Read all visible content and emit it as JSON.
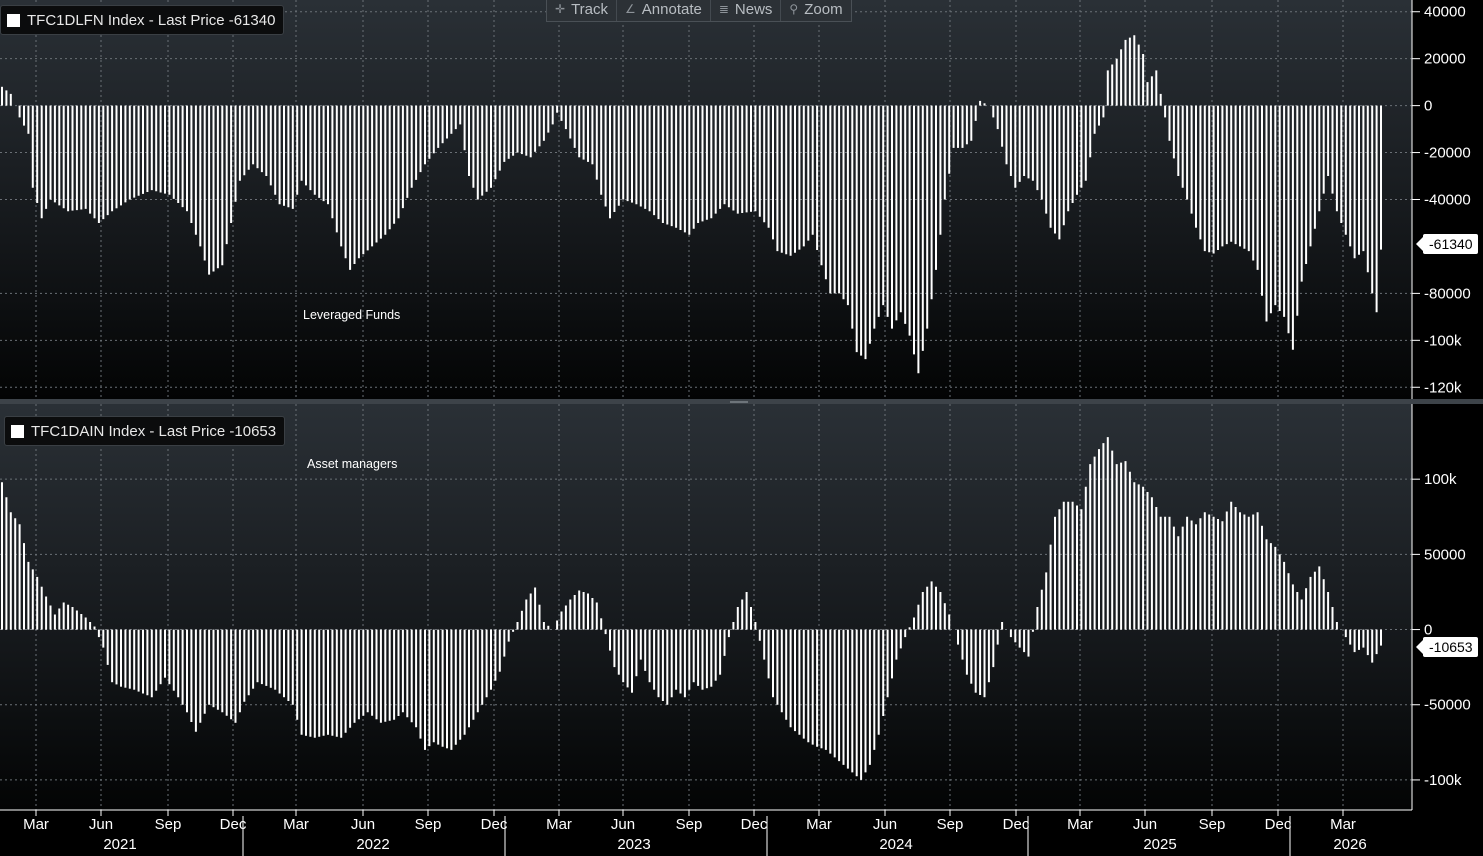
{
  "toolbar": {
    "track_label": "Track",
    "annotate_label": "Annotate",
    "news_label": "News",
    "zoom_label": "Zoom",
    "track_icon": "crosshair-icon",
    "annotate_icon": "pencil-icon",
    "news_icon": "news-icon",
    "zoom_icon": "magnifier-icon"
  },
  "x_axis": {
    "month_ticks": [
      "Mar",
      "Jun",
      "Sep",
      "Dec",
      "Mar",
      "Jun",
      "Sep",
      "Dec",
      "Mar",
      "Jun",
      "Sep",
      "Dec",
      "Mar",
      "Jun",
      "Sep",
      "Dec",
      "Mar",
      "Jun",
      "Sep",
      "Dec",
      "Mar"
    ],
    "years": [
      "2021",
      "2022",
      "2023",
      "2024",
      "2025",
      "2026"
    ]
  },
  "chart_data": [
    {
      "type": "bar",
      "legend": "TFC1DLFN Index - Last Price -61340",
      "annotation": "Leveraged Funds",
      "last_value": -61340,
      "last_label": "-61340",
      "ylim": [
        -125000,
        45000
      ],
      "yticks": [
        40000,
        20000,
        0,
        -20000,
        -40000,
        -80000,
        -100000,
        -120000
      ],
      "yticklabels": [
        "40000",
        "20000",
        "0",
        "-20000",
        "-40000",
        "-80000",
        "-100k",
        "-120k"
      ],
      "grid": true,
      "color": "#ffffff",
      "anchors": [
        [
          0,
          8000
        ],
        [
          2,
          5000
        ],
        [
          4,
          -5000
        ],
        [
          6,
          -12000
        ],
        [
          7,
          -35000
        ],
        [
          9,
          -48000
        ],
        [
          11,
          -40000
        ],
        [
          15,
          -45000
        ],
        [
          19,
          -44000
        ],
        [
          22,
          -50000
        ],
        [
          25,
          -45000
        ],
        [
          29,
          -40000
        ],
        [
          34,
          -36000
        ],
        [
          38,
          -38000
        ],
        [
          42,
          -45000
        ],
        [
          45,
          -60000
        ],
        [
          47,
          -72000
        ],
        [
          50,
          -68000
        ],
        [
          52,
          -50000
        ],
        [
          54,
          -32000
        ],
        [
          57,
          -25000
        ],
        [
          60,
          -30000
        ],
        [
          63,
          -42000
        ],
        [
          66,
          -44000
        ],
        [
          68,
          -32000
        ],
        [
          71,
          -38000
        ],
        [
          74,
          -42000
        ],
        [
          77,
          -60000
        ],
        [
          79,
          -70000
        ],
        [
          81,
          -65000
        ],
        [
          84,
          -60000
        ],
        [
          87,
          -55000
        ],
        [
          90,
          -48000
        ],
        [
          93,
          -35000
        ],
        [
          96,
          -25000
        ],
        [
          99,
          -18000
        ],
        [
          102,
          -12000
        ],
        [
          104,
          -8000
        ],
        [
          106,
          -30000
        ],
        [
          108,
          -40000
        ],
        [
          111,
          -35000
        ],
        [
          114,
          -24000
        ],
        [
          117,
          -20000
        ],
        [
          120,
          -22000
        ],
        [
          123,
          -15000
        ],
        [
          125,
          -8000
        ],
        [
          126,
          -3000
        ],
        [
          128,
          -10000
        ],
        [
          131,
          -22000
        ],
        [
          134,
          -25000
        ],
        [
          136,
          -38000
        ],
        [
          138,
          -48000
        ],
        [
          141,
          -40000
        ],
        [
          144,
          -42000
        ],
        [
          147,
          -45000
        ],
        [
          150,
          -50000
        ],
        [
          153,
          -52000
        ],
        [
          156,
          -55000
        ],
        [
          158,
          -50000
        ],
        [
          161,
          -48000
        ],
        [
          164,
          -42000
        ],
        [
          167,
          -46000
        ],
        [
          171,
          -45000
        ],
        [
          174,
          -52000
        ],
        [
          176,
          -62000
        ],
        [
          179,
          -64000
        ],
        [
          182,
          -60000
        ],
        [
          184,
          -55000
        ],
        [
          186,
          -68000
        ],
        [
          188,
          -80000
        ],
        [
          190,
          -80000
        ],
        [
          192,
          -85000
        ],
        [
          194,
          -105000
        ],
        [
          196,
          -108000
        ],
        [
          198,
          -95000
        ],
        [
          200,
          -85000
        ],
        [
          202,
          -95000
        ],
        [
          204,
          -88000
        ],
        [
          206,
          -98000
        ],
        [
          208,
          -114000
        ],
        [
          210,
          -95000
        ],
        [
          212,
          -70000
        ],
        [
          214,
          -40000
        ],
        [
          216,
          -18000
        ],
        [
          218,
          -18000
        ],
        [
          220,
          -15000
        ],
        [
          222,
          2000
        ],
        [
          224,
          0
        ],
        [
          226,
          -10000
        ],
        [
          228,
          -25000
        ],
        [
          230,
          -35000
        ],
        [
          232,
          -30000
        ],
        [
          234,
          -32000
        ],
        [
          236,
          -40000
        ],
        [
          238,
          -52000
        ],
        [
          240,
          -57000
        ],
        [
          242,
          -45000
        ],
        [
          244,
          -38000
        ],
        [
          246,
          -32000
        ],
        [
          248,
          -12000
        ],
        [
          250,
          -5000
        ],
        [
          251,
          15000
        ],
        [
          253,
          20000
        ],
        [
          255,
          28000
        ],
        [
          257,
          30000
        ],
        [
          259,
          22000
        ],
        [
          260,
          10000
        ],
        [
          262,
          15000
        ],
        [
          263,
          5000
        ],
        [
          265,
          -15000
        ],
        [
          267,
          -30000
        ],
        [
          269,
          -40000
        ],
        [
          271,
          -52000
        ],
        [
          273,
          -62000
        ],
        [
          275,
          -63000
        ],
        [
          277,
          -60000
        ],
        [
          279,
          -58000
        ],
        [
          281,
          -60000
        ],
        [
          283,
          -62000
        ],
        [
          285,
          -70000
        ],
        [
          287,
          -92000
        ],
        [
          289,
          -85000
        ],
        [
          291,
          -90000
        ],
        [
          293,
          -104000
        ],
        [
          295,
          -75000
        ],
        [
          297,
          -60000
        ],
        [
          299,
          -45000
        ],
        [
          301,
          -30000
        ],
        [
          303,
          -45000
        ],
        [
          305,
          -55000
        ],
        [
          307,
          -65000
        ],
        [
          309,
          -62000
        ],
        [
          311,
          -80000
        ],
        [
          312,
          -88000
        ],
        [
          313,
          -61340
        ]
      ]
    },
    {
      "type": "bar",
      "legend": "TFC1DAIN Index - Last Price -10653",
      "annotation": "Asset managers",
      "last_value": -10653,
      "last_label": "-10653",
      "ylim": [
        -120000,
        150000
      ],
      "yticks": [
        100000,
        50000,
        0,
        -50000,
        -100000
      ],
      "yticklabels": [
        "100k",
        "50000",
        "0",
        "-50000",
        "-100k"
      ],
      "grid": true,
      "color": "#ffffff",
      "anchors": [
        [
          0,
          98000
        ],
        [
          2,
          78000
        ],
        [
          4,
          70000
        ],
        [
          6,
          45000
        ],
        [
          8,
          35000
        ],
        [
          10,
          22000
        ],
        [
          12,
          10000
        ],
        [
          14,
          18000
        ],
        [
          16,
          15000
        ],
        [
          19,
          8000
        ],
        [
          21,
          2000
        ],
        [
          23,
          -12000
        ],
        [
          25,
          -35000
        ],
        [
          27,
          -38000
        ],
        [
          30,
          -40000
        ],
        [
          34,
          -45000
        ],
        [
          37,
          -32000
        ],
        [
          40,
          -45000
        ],
        [
          42,
          -55000
        ],
        [
          44,
          -68000
        ],
        [
          47,
          -50000
        ],
        [
          50,
          -55000
        ],
        [
          53,
          -62000
        ],
        [
          55,
          -48000
        ],
        [
          58,
          -35000
        ],
        [
          62,
          -40000
        ],
        [
          66,
          -50000
        ],
        [
          68,
          -70000
        ],
        [
          71,
          -72000
        ],
        [
          74,
          -70000
        ],
        [
          77,
          -72000
        ],
        [
          80,
          -62000
        ],
        [
          83,
          -55000
        ],
        [
          86,
          -62000
        ],
        [
          89,
          -60000
        ],
        [
          91,
          -55000
        ],
        [
          94,
          -65000
        ],
        [
          96,
          -80000
        ],
        [
          98,
          -75000
        ],
        [
          100,
          -78000
        ],
        [
          102,
          -80000
        ],
        [
          105,
          -70000
        ],
        [
          108,
          -55000
        ],
        [
          111,
          -40000
        ],
        [
          113,
          -28000
        ],
        [
          115,
          -8000
        ],
        [
          117,
          5000
        ],
        [
          119,
          20000
        ],
        [
          121,
          28000
        ],
        [
          123,
          5000
        ],
        [
          125,
          0
        ],
        [
          127,
          12000
        ],
        [
          129,
          20000
        ],
        [
          131,
          26000
        ],
        [
          133,
          24000
        ],
        [
          135,
          18000
        ],
        [
          137,
          -3000
        ],
        [
          139,
          -25000
        ],
        [
          141,
          -35000
        ],
        [
          143,
          -42000
        ],
        [
          145,
          -20000
        ],
        [
          147,
          -35000
        ],
        [
          149,
          -45000
        ],
        [
          151,
          -50000
        ],
        [
          153,
          -40000
        ],
        [
          155,
          -45000
        ],
        [
          157,
          -35000
        ],
        [
          159,
          -40000
        ],
        [
          161,
          -38000
        ],
        [
          163,
          -30000
        ],
        [
          165,
          -5000
        ],
        [
          167,
          15000
        ],
        [
          169,
          25000
        ],
        [
          171,
          5000
        ],
        [
          173,
          -20000
        ],
        [
          175,
          -45000
        ],
        [
          177,
          -55000
        ],
        [
          179,
          -65000
        ],
        [
          181,
          -70000
        ],
        [
          183,
          -75000
        ],
        [
          185,
          -78000
        ],
        [
          187,
          -80000
        ],
        [
          189,
          -85000
        ],
        [
          191,
          -90000
        ],
        [
          193,
          -95000
        ],
        [
          195,
          -100000
        ],
        [
          197,
          -90000
        ],
        [
          199,
          -70000
        ],
        [
          201,
          -45000
        ],
        [
          203,
          -20000
        ],
        [
          205,
          -5000
        ],
        [
          207,
          8000
        ],
        [
          209,
          25000
        ],
        [
          211,
          32000
        ],
        [
          213,
          25000
        ],
        [
          215,
          10000
        ],
        [
          217,
          -10000
        ],
        [
          219,
          -30000
        ],
        [
          221,
          -42000
        ],
        [
          223,
          -45000
        ],
        [
          225,
          -25000
        ],
        [
          227,
          5000
        ],
        [
          229,
          -5000
        ],
        [
          231,
          -12000
        ],
        [
          233,
          -18000
        ],
        [
          235,
          15000
        ],
        [
          237,
          38000
        ],
        [
          239,
          75000
        ],
        [
          241,
          85000
        ],
        [
          243,
          85000
        ],
        [
          245,
          80000
        ],
        [
          247,
          110000
        ],
        [
          249,
          120000
        ],
        [
          251,
          128000
        ],
        [
          253,
          110000
        ],
        [
          255,
          112000
        ],
        [
          257,
          98000
        ],
        [
          259,
          95000
        ],
        [
          261,
          88000
        ],
        [
          263,
          75000
        ],
        [
          265,
          75000
        ],
        [
          267,
          62000
        ],
        [
          269,
          75000
        ],
        [
          271,
          70000
        ],
        [
          273,
          78000
        ],
        [
          275,
          75000
        ],
        [
          277,
          72000
        ],
        [
          279,
          85000
        ],
        [
          281,
          78000
        ],
        [
          283,
          75000
        ],
        [
          285,
          78000
        ],
        [
          287,
          60000
        ],
        [
          289,
          55000
        ],
        [
          291,
          45000
        ],
        [
          293,
          30000
        ],
        [
          295,
          20000
        ],
        [
          297,
          35000
        ],
        [
          299,
          42000
        ],
        [
          301,
          25000
        ],
        [
          303,
          5000
        ],
        [
          305,
          -5000
        ],
        [
          307,
          -15000
        ],
        [
          309,
          -12000
        ],
        [
          311,
          -22000
        ],
        [
          313,
          -10653
        ]
      ]
    }
  ]
}
